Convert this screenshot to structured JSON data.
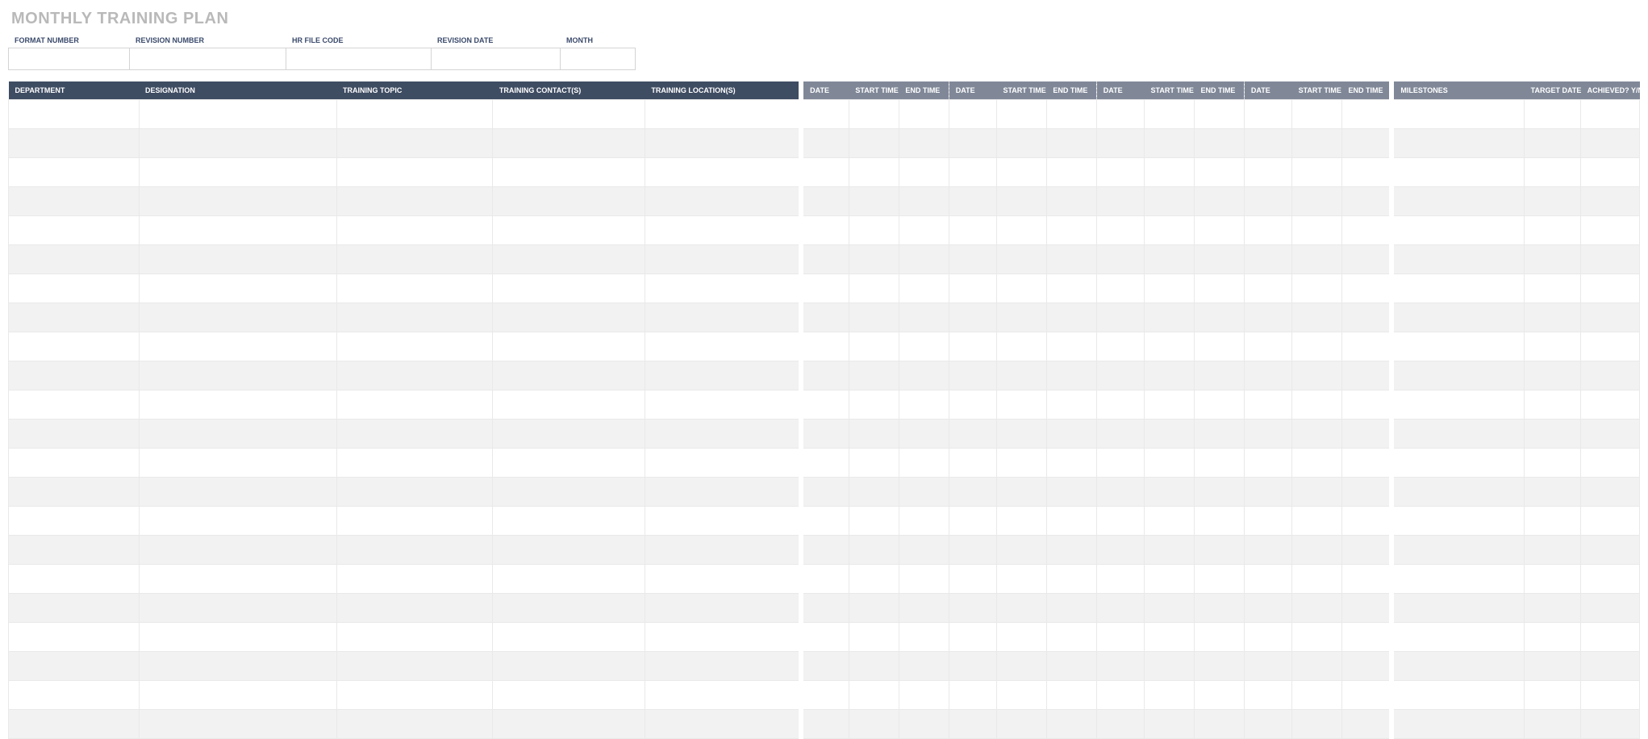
{
  "title": "MONTHLY TRAINING PLAN",
  "meta": {
    "labels": {
      "format_number": "FORMAT NUMBER",
      "revision_number": "REVISION NUMBER",
      "hr_file_code": "HR FILE CODE",
      "revision_date": "REVISION DATE",
      "month": "MONTH"
    },
    "values": {
      "format_number": "",
      "revision_number": "",
      "hr_file_code": "",
      "revision_date": "",
      "month": ""
    }
  },
  "columns": {
    "department": "DEPARTMENT",
    "designation": "DESIGNATION",
    "training_topic": "TRAINING TOPIC",
    "training_contacts": "TRAINING CONTACT(S)",
    "training_locations": "TRAINING LOCATION(S)",
    "date": "DATE",
    "start_time": "START TIME",
    "end_time": "END TIME",
    "milestones": "MILESTONES",
    "target_date": "TARGET DATE",
    "achieved": "ACHIEVED? Y/N"
  },
  "date_groups": 4,
  "rows": 22
}
